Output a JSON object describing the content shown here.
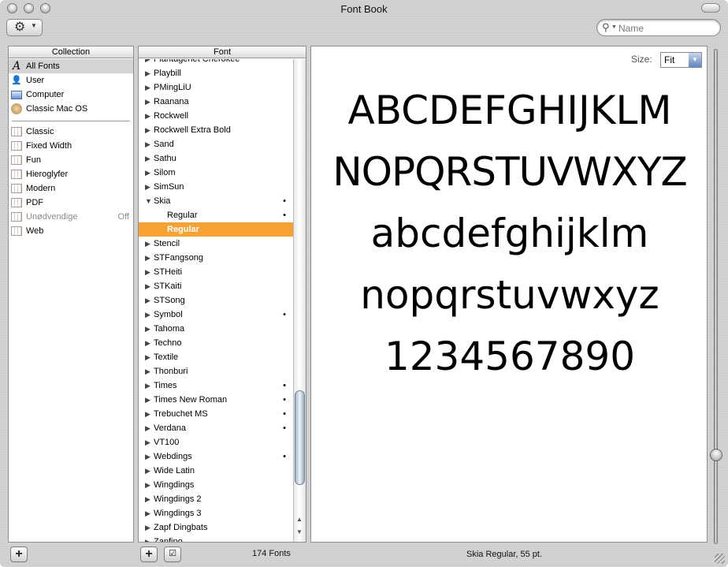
{
  "window": {
    "title": "Font Book"
  },
  "toolbar": {
    "search_placeholder": "Name"
  },
  "collection": {
    "header": "Collection",
    "primary": [
      {
        "label": "All Fonts",
        "icon": "all-fonts-icon",
        "selected": true
      },
      {
        "label": "User",
        "icon": "user-icon"
      },
      {
        "label": "Computer",
        "icon": "computer-icon"
      },
      {
        "label": "Classic Mac OS",
        "icon": "classic-mac-os-icon"
      }
    ],
    "secondary": [
      {
        "label": "Classic",
        "icon": "book-icon"
      },
      {
        "label": "Fixed Width",
        "icon": "book-icon"
      },
      {
        "label": "Fun",
        "icon": "book-icon"
      },
      {
        "label": "Hieroglyfer",
        "icon": "book-icon"
      },
      {
        "label": "Modern",
        "icon": "book-icon"
      },
      {
        "label": "PDF",
        "icon": "book-icon"
      },
      {
        "label": "Unødvendige",
        "icon": "book-icon",
        "status": "Off"
      },
      {
        "label": "Web",
        "icon": "book-icon"
      }
    ]
  },
  "font": {
    "header": "Font",
    "items": [
      {
        "label": "Plantagenet Cherokee",
        "level": 0,
        "dot": false
      },
      {
        "label": "Playbill",
        "level": 0,
        "dot": false
      },
      {
        "label": "PMingLiU",
        "level": 0,
        "dot": false
      },
      {
        "label": "Raanana",
        "level": 0,
        "dot": false
      },
      {
        "label": "Rockwell",
        "level": 0,
        "dot": false
      },
      {
        "label": "Rockwell Extra Bold",
        "level": 0,
        "dot": false
      },
      {
        "label": "Sand",
        "level": 0,
        "dot": false
      },
      {
        "label": "Sathu",
        "level": 0,
        "dot": false
      },
      {
        "label": "Silom",
        "level": 0,
        "dot": false
      },
      {
        "label": "SimSun",
        "level": 0,
        "dot": false
      },
      {
        "label": "Skia",
        "level": 0,
        "dot": true,
        "expanded": true
      },
      {
        "label": "Regular",
        "level": 1,
        "dot": true
      },
      {
        "label": "Regular",
        "level": 1,
        "dot": false,
        "selected": true
      },
      {
        "label": "Stencil",
        "level": 0,
        "dot": false
      },
      {
        "label": "STFangsong",
        "level": 0,
        "dot": false
      },
      {
        "label": "STHeiti",
        "level": 0,
        "dot": false
      },
      {
        "label": "STKaiti",
        "level": 0,
        "dot": false
      },
      {
        "label": "STSong",
        "level": 0,
        "dot": false
      },
      {
        "label": "Symbol",
        "level": 0,
        "dot": true
      },
      {
        "label": "Tahoma",
        "level": 0,
        "dot": false
      },
      {
        "label": "Techno",
        "level": 0,
        "dot": false
      },
      {
        "label": "Textile",
        "level": 0,
        "dot": false
      },
      {
        "label": "Thonburi",
        "level": 0,
        "dot": false
      },
      {
        "label": "Times",
        "level": 0,
        "dot": true
      },
      {
        "label": "Times New Roman",
        "level": 0,
        "dot": true
      },
      {
        "label": "Trebuchet MS",
        "level": 0,
        "dot": true
      },
      {
        "label": "Verdana",
        "level": 0,
        "dot": true
      },
      {
        "label": "VT100",
        "level": 0,
        "dot": false
      },
      {
        "label": "Webdings",
        "level": 0,
        "dot": true
      },
      {
        "label": "Wide Latin",
        "level": 0,
        "dot": false
      },
      {
        "label": "Wingdings",
        "level": 0,
        "dot": false
      },
      {
        "label": "Wingdings 2",
        "level": 0,
        "dot": false
      },
      {
        "label": "Wingdings 3",
        "level": 0,
        "dot": false
      },
      {
        "label": "Zapf Dingbats",
        "level": 0,
        "dot": false
      },
      {
        "label": "Zapfino",
        "level": 0,
        "dot": false
      }
    ]
  },
  "preview": {
    "size_label": "Size:",
    "size_value": "Fit",
    "lines": [
      "ABCDEFGHIJKLM",
      "NOPQRSTUVWXYZ",
      "abcdefghijklm",
      "nopqrstuvwxyz",
      "1234567890"
    ],
    "size_slider_fraction": 0.81
  },
  "status": {
    "font_count": "174 Fonts",
    "selection": "Skia Regular, 55 pt."
  },
  "colors": {
    "selection": "#f7a034"
  }
}
